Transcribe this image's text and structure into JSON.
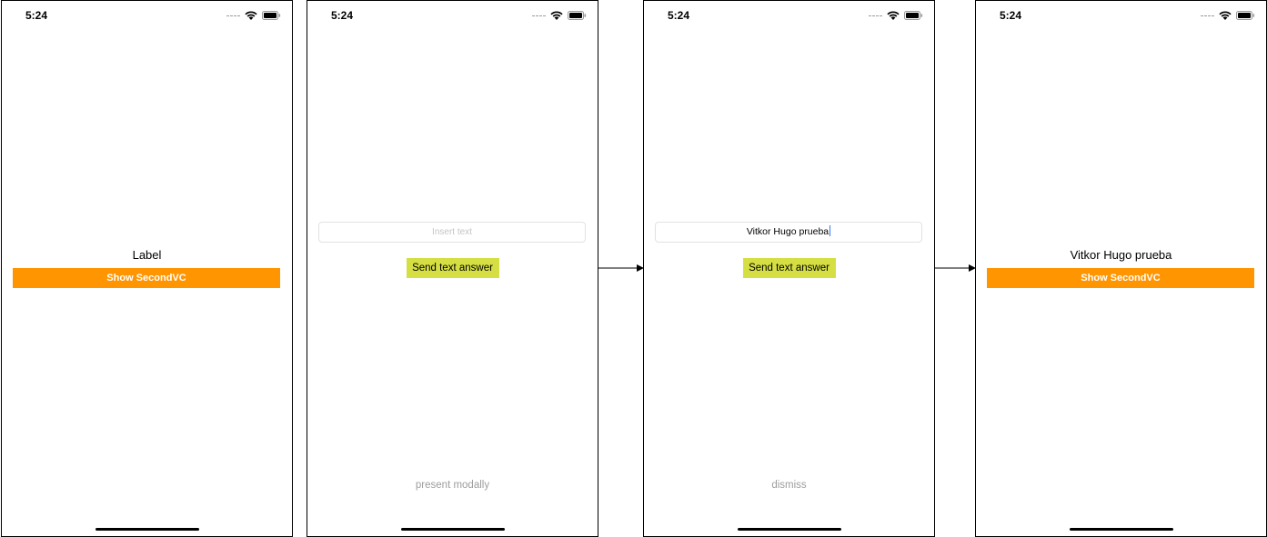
{
  "status_bar": {
    "time": "5:24",
    "icons": [
      "signal-dots-icon",
      "wifi-icon",
      "battery-icon"
    ]
  },
  "screens": [
    {
      "label": "Label",
      "button": "Show SecondVC"
    },
    {
      "text_field": {
        "placeholder": "Insert text",
        "value": ""
      },
      "send_button": "Send text answer",
      "caption": "present modally"
    },
    {
      "text_field": {
        "placeholder": "Insert text",
        "value": "Vitkor Hugo prueba"
      },
      "send_button": "Send text answer",
      "caption": "dismiss"
    },
    {
      "label": "Vitkor Hugo prueba",
      "button": "Show SecondVC"
    }
  ],
  "colors": {
    "orange_button": "#ff9500",
    "send_button": "#d5df43",
    "caption_gray": "#9d9d9d",
    "caret_blue": "#3478f6"
  }
}
